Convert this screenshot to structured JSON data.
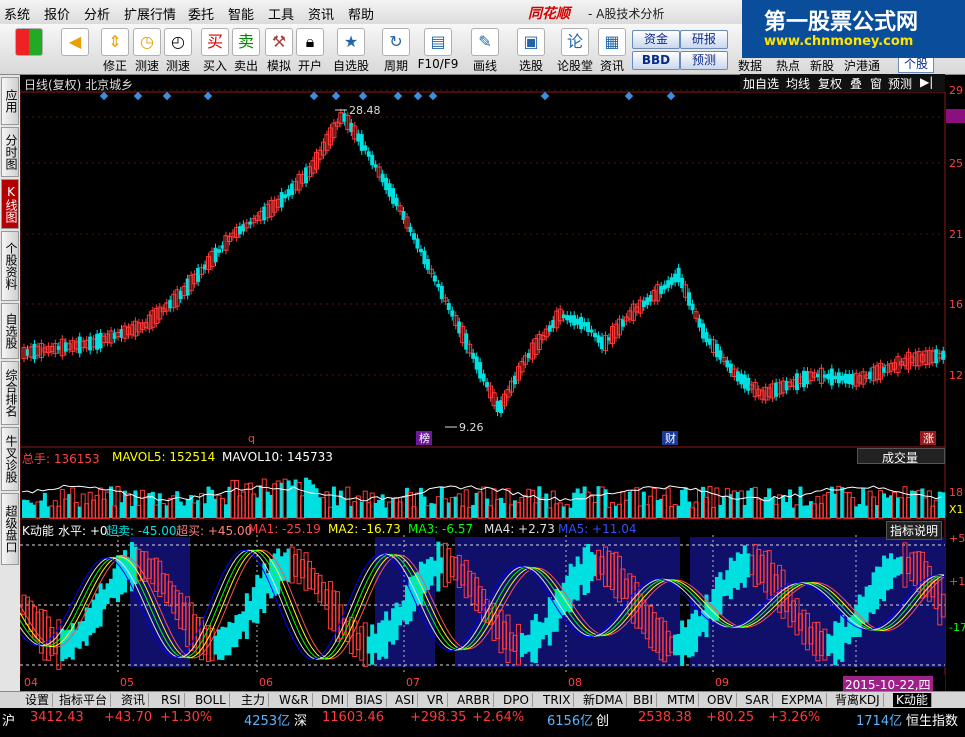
{
  "menu": {
    "items": [
      "系统",
      "报价",
      "分析",
      "扩展行情",
      "委托",
      "智能",
      "工具",
      "资讯",
      "帮助"
    ],
    "brand": "同花顺",
    "title": "- A股技术分析"
  },
  "toolbar": {
    "buttons": [
      {
        "label": "",
        "icon": "grid-icon"
      },
      {
        "label": "",
        "icon": "back-arrow-icon"
      },
      {
        "label": "修正",
        "icon": "arrow-updown-icon"
      },
      {
        "label": "测速",
        "icon": "clock-icon"
      },
      {
        "label": "测速",
        "icon": "clock-icon"
      },
      {
        "label": "买入",
        "icon": "buy-icon"
      },
      {
        "label": "卖出",
        "icon": "sell-icon"
      },
      {
        "label": "模拟",
        "icon": "hammer-icon"
      },
      {
        "label": "开户",
        "icon": "lock-icon"
      },
      {
        "label": "自选股",
        "icon": "star-icon"
      },
      {
        "label": "周期",
        "icon": "cycle-icon"
      },
      {
        "label": "F10/F9",
        "icon": "f10-icon"
      },
      {
        "label": "画线",
        "icon": "pen-icon"
      },
      {
        "label": "选股",
        "icon": "screen-icon"
      },
      {
        "label": "论股堂",
        "icon": "forum-icon"
      },
      {
        "label": "资讯",
        "icon": "news-icon"
      }
    ],
    "small_buttons": [
      "资金",
      "研报",
      "BBD",
      "预测"
    ],
    "right_labels": [
      "数据",
      "热点",
      "新股",
      "沪港通",
      "个股"
    ]
  },
  "logo": {
    "line1": "第一股票公式网",
    "line2": "www.chnmoney.com"
  },
  "sidetabs": [
    "应用",
    "分时图",
    "K线图",
    "个股资料",
    "自选股",
    "综合排名",
    "牛叉诊股",
    "超级盘口"
  ],
  "chart": {
    "header": "日线(复权) 北京城乡",
    "subbar": [
      "加自选",
      "均线",
      "复权",
      "叠",
      "窗",
      "预测"
    ],
    "price_axis": [
      "29",
      "27",
      "25",
      "21",
      "16",
      "12"
    ],
    "high_label": "28.48",
    "low_label": "9.26",
    "markers": [
      "q",
      "榜",
      "财",
      "涨"
    ],
    "volume_header": {
      "total": "总手: 136153",
      "mavol5": "MAVOL5: 152514",
      "mavol10": "MAVOL10: 145733"
    },
    "volume_selector": "成交量",
    "volume_axis": [
      "18",
      "X1"
    ],
    "indicator_header": {
      "name": "K动能",
      "level": "水平: +0",
      "oversell": "超卖: -45.00",
      "overbuy": "超买: +45.00",
      "ma1": "MA1: -25.19",
      "ma2": "MA2: -16.73",
      "ma3": "MA3: -6.57",
      "ma4": "MA4: +2.73",
      "ma5": "MA5: +11.04"
    },
    "indicator_button": "指标说明",
    "indicator_axis": [
      "+5",
      "+1",
      "-17"
    ],
    "x_labels": [
      "04",
      "05",
      "06",
      "07",
      "08",
      "09"
    ],
    "date_label": "2015-10-22,四"
  },
  "bottom_tabs": [
    "设置",
    "指标平台",
    "资讯",
    "RSI",
    "BOLL",
    "主力",
    "W&R",
    "DMI",
    "BIAS",
    "ASI",
    "VR",
    "ARBR",
    "DPO",
    "TRIX",
    "新DMA",
    "BBI",
    "MTM",
    "OBV",
    "SAR",
    "EXPMA",
    "背离KDJ",
    "K动能"
  ],
  "status": {
    "sh_label": "沪",
    "sh_value": "3412.43",
    "sh_change": "+43.70",
    "sh_pct": "+1.30%",
    "sh_amount": "4253亿",
    "sz_label": "深",
    "sz_value": "11603.46",
    "sz_change": "+298.35",
    "sz_pct": "+2.64%",
    "sz_amount": "6156亿",
    "cy_label": "创",
    "cy_value": "2538.38",
    "cy_change": "+80.25",
    "cy_pct": "+3.26%",
    "cy_amount": "1714亿",
    "hs_label": "恒生指数"
  },
  "colors": {
    "up": "#ff3a3a",
    "down": "#00e0e0",
    "ma1": "#ff5050",
    "ma2": "#ffff00",
    "ma3": "#00ff00",
    "ma4": "#e0e0e0",
    "ma5": "#0000ff"
  }
}
